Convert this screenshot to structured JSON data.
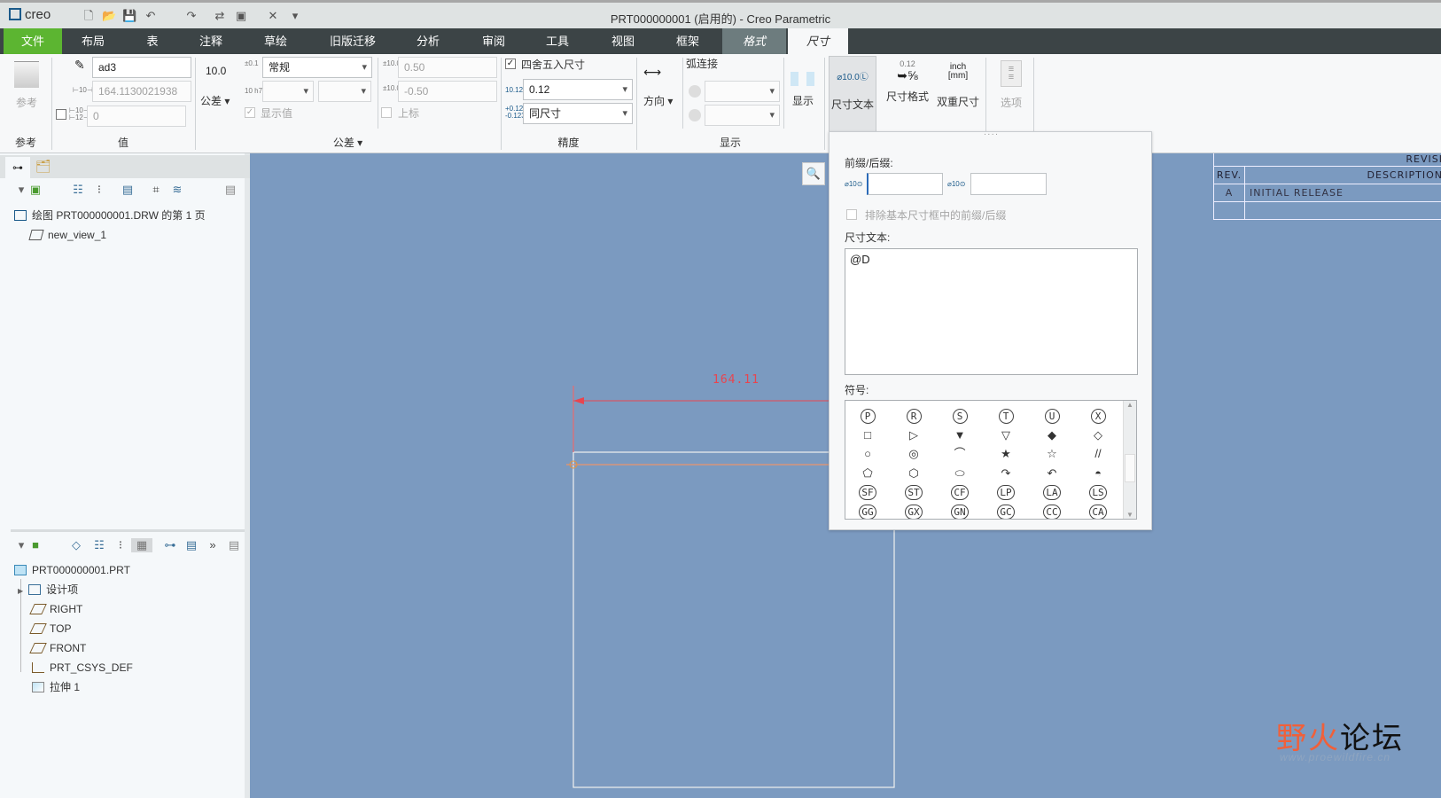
{
  "app": {
    "logo": "creo",
    "title": "PRT000000001 (启用的) - Creo Parametric"
  },
  "menu": [
    "文件",
    "布局",
    "表",
    "注释",
    "草绘",
    "旧版迁移",
    "分析",
    "审阅",
    "工具",
    "视图",
    "框架",
    "格式",
    "尺寸"
  ],
  "ribbon": {
    "reference": {
      "label": "参考",
      "group": "参考"
    },
    "value": {
      "name": "ad3",
      "dim_value": "164.1130021938",
      "override": "0",
      "group": "值"
    },
    "tolerance": {
      "sample": "10.0",
      "mode_btn": "公差",
      "mode": "常规",
      "upper": "0.50",
      "lower": "-0.50",
      "show_value": "显示值",
      "superscript": "上标",
      "group": "公差",
      "tol_icon": "±0.1",
      "fit_icon": "10 h7"
    },
    "precision": {
      "round": "四舍五入尺寸",
      "decimals": "0.12",
      "tol_decimals": "同尺寸",
      "group": "精度"
    },
    "display": {
      "direction": "方向",
      "arc": "弧连接",
      "show": "显示",
      "group": "显示"
    },
    "dim_text": {
      "sample": "⌀10.0Ⓛ",
      "label": "尺寸文本"
    },
    "dim_format": {
      "sample_top": "0.12",
      "sample_frac": "⅝",
      "label": "尺寸格式"
    },
    "dual": {
      "top": "inch",
      "bottom": "[mm]",
      "label": "双重尺寸"
    },
    "options": {
      "label": "选项"
    }
  },
  "drawing_tree": {
    "items": [
      "绘图 PRT000000001.DRW 的第 1 页",
      "new_view_1"
    ]
  },
  "model_tree": {
    "items": [
      "PRT000000001.PRT",
      "设计项",
      "RIGHT",
      "TOP",
      "FRONT",
      "PRT_CSYS_DEF",
      "拉伸 1"
    ]
  },
  "popup": {
    "prefix_suffix_label": "前缀/后缀:",
    "prefix": "",
    "suffix": "",
    "prefix_icon": "⌀10⊙",
    "suffix_icon": "⌀10⊙",
    "exclude_label": "排除基本尺寸框中的前缀/后缀",
    "dim_text_label": "尺寸文本:",
    "dim_text": "@D",
    "symbols_label": "符号:",
    "symbols": [
      [
        "P",
        "R",
        "S",
        "T",
        "U",
        "X"
      ],
      [
        "□",
        "▷",
        "▼",
        "▽",
        "◆",
        "◇"
      ],
      [
        "○",
        "◎",
        "⌒",
        "★",
        "☆",
        "//"
      ],
      [
        "⬠",
        "⬡",
        "⬭",
        "↷",
        "↶",
        "◓"
      ],
      [
        "SF",
        "ST",
        "CF",
        "LP",
        "LA",
        "LS"
      ],
      [
        "GG",
        "GX",
        "GN",
        "GC",
        "CC",
        "CA"
      ]
    ]
  },
  "canvas": {
    "dimension": "164.11",
    "rev_table": {
      "title": "REVISI",
      "headers": [
        "REV.",
        "DESCRIPTION"
      ],
      "rows": [
        [
          "A",
          "INITIAL RELEASE"
        ],
        [
          "",
          ""
        ]
      ]
    }
  },
  "watermark": {
    "text": "野火论坛",
    "url": "www.proewildfire.cn"
  },
  "colors": {
    "menu_bg": "#3c4446",
    "file_tab": "#5cb531",
    "canvas": "#7b9ac0",
    "dim": "#e8454f"
  }
}
